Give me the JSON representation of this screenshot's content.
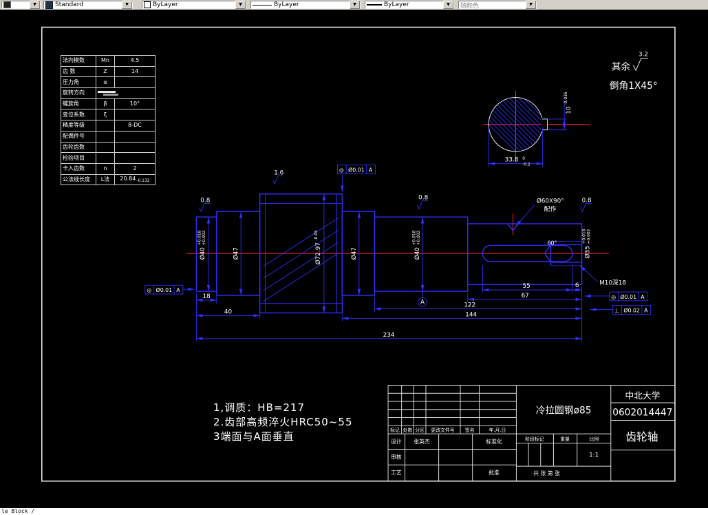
{
  "toolbar": {
    "style": "Standard",
    "color": "ByLayer",
    "linetype": "ByLayer",
    "lineweight": "ByLayer",
    "plot_style": "随颜色"
  },
  "command_line": "le Block /",
  "param_table": {
    "rows": [
      {
        "label": "法向模数",
        "sym": "Mn",
        "value": "4.5"
      },
      {
        "label": "齿  数",
        "sym": "Z",
        "value": "14"
      },
      {
        "label": "压力角",
        "sym": "α",
        "value": ""
      },
      {
        "label": "旋转方向",
        "sym": "",
        "value": ""
      },
      {
        "label": "螺旋角",
        "sym": "β",
        "value": "10°"
      },
      {
        "label": "变位系数",
        "sym": "ξ",
        "value": ""
      },
      {
        "label": "精度等级",
        "sym": "",
        "value": "8-DC"
      },
      {
        "label": "配偶件号",
        "sym": "",
        "value": ""
      },
      {
        "label": "齿轮齿数",
        "sym": "",
        "value": ""
      },
      {
        "label": "检验项目",
        "sym": "",
        "value": ""
      },
      {
        "label": "卡入齿数",
        "sym": "n",
        "value": "2"
      },
      {
        "label": "公法线长度",
        "sym": "L法",
        "value": "20.84",
        "tol": "-0.132"
      }
    ]
  },
  "corner": {
    "qiyu": "其余",
    "roughness": "3.2",
    "chamfer": "倒角1X45°"
  },
  "section_view": {
    "width": "33.8",
    "width_tol_u": "0",
    "width_tol_l": "-0.2",
    "key_width": "10",
    "key_tol": "-0.036"
  },
  "dims": {
    "l18": "18",
    "l40": "40",
    "l55": "55",
    "l6": "6",
    "l67": "67",
    "l122": "122",
    "l144": "144",
    "l234": "234"
  },
  "dia": {
    "d40l": "Ø40",
    "d40l_tu": "+0.018",
    "d40l_tl": "+0.002",
    "d47l": "Ø47",
    "dgear": "Ø72.97",
    "dgear_t": "-0.05",
    "d47r": "Ø47",
    "d40r": "Ø40",
    "d40r_tu": "+0.018",
    "d40r_tl": "+0.002",
    "d35": "Ø35",
    "d35_tu": "+0.018",
    "d35_tl": "+0.002"
  },
  "surface": {
    "gear": "1.6",
    "left": "0.8",
    "mid": "0.8",
    "right": "0.8"
  },
  "gdt": {
    "top": {
      "sym": "◎",
      "tol": "Ø0.01",
      "datum": "A"
    },
    "left": {
      "sym": "◎",
      "tol": "Ø0.01",
      "datum": "A"
    },
    "right_coax": {
      "sym": "◎",
      "tol": "Ø0.01",
      "datum": "A"
    },
    "right_perp": {
      "sym": "⊥",
      "tol": "Ø0.02",
      "datum": "A"
    },
    "datum_label": "A"
  },
  "thread": {
    "label": "M10深18",
    "angle": "60°"
  },
  "countersink": {
    "line1": "Ø60X90°",
    "line2": "配作"
  },
  "notes": [
    "1,调质：HB=217",
    "2.齿部高频淬火HRC50~55",
    "3端面与A面垂直"
  ],
  "title_block": {
    "material": "冷拉圆钢ø85",
    "school": "中北大学",
    "number": "0602014447",
    "part_name": "齿轮轴",
    "rev_headers": [
      "标记",
      "处数",
      "分区",
      "更改文件号",
      "签名",
      "年.月.日"
    ],
    "design": "设计",
    "check": "审核",
    "process": "工艺",
    "standardize": "标准化",
    "approve": "批准",
    "design_sig": "张英杰",
    "stage": "阶段标记",
    "weight": "重量",
    "scale": "比例",
    "scale_value": "1:1",
    "sheets": "共  张  第  张"
  }
}
